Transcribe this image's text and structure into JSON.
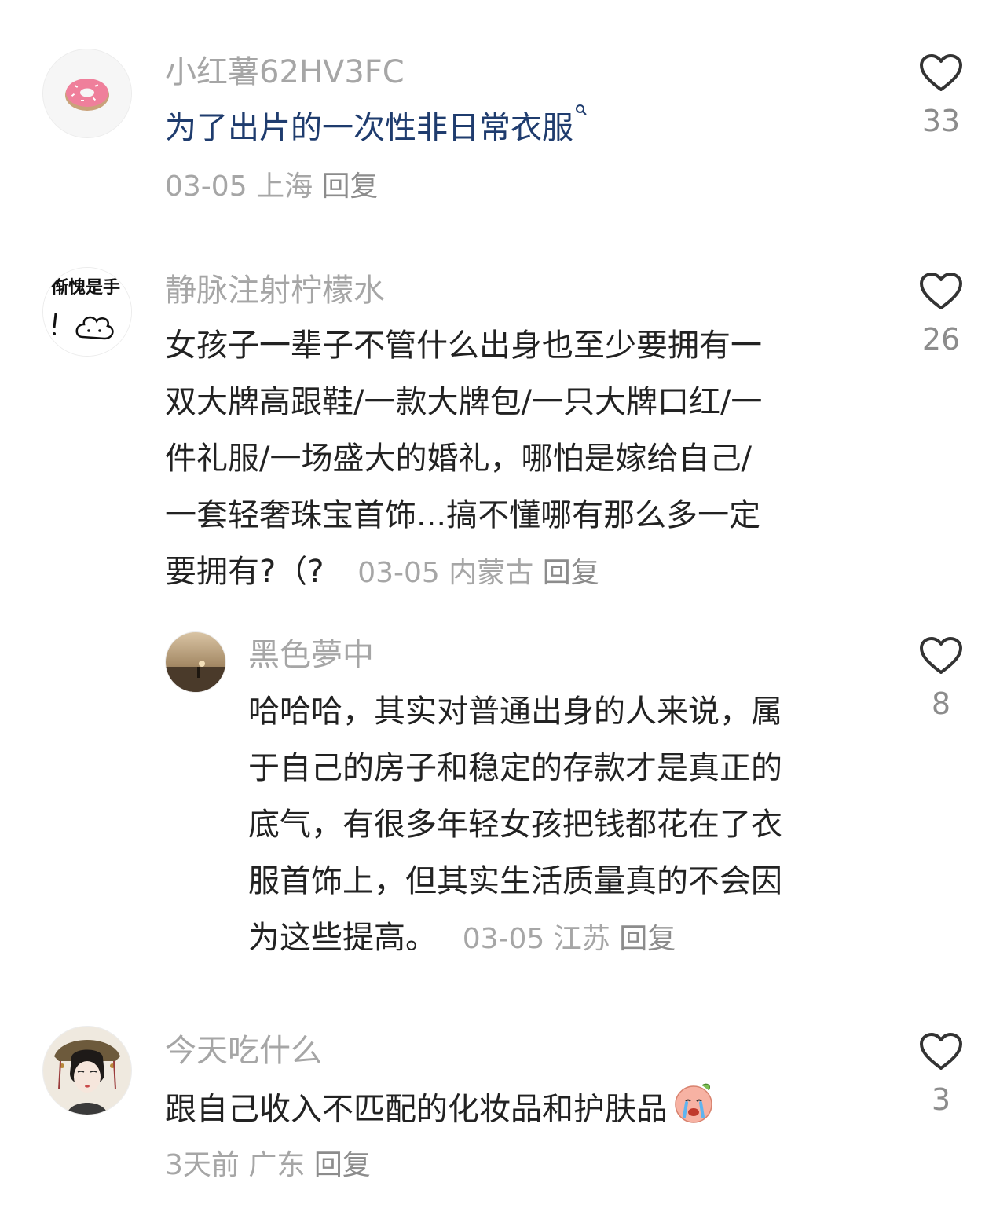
{
  "comments": [
    {
      "username": "小红薯62HV3FC",
      "avatar_icon": "donut-avatar",
      "content": "为了出片的一次性非日常衣服",
      "search_icon": "search-icon",
      "date": "03-05",
      "location": "上海",
      "reply_label": "回复",
      "likes": "33"
    },
    {
      "username": "静脉注射柠檬水",
      "avatar_icon": "handwritten-avatar",
      "avatar_text": "惭愧是手",
      "content_lines": [
        "女孩子一辈子不管什么出身也至少要拥有一",
        "双大牌高跟鞋/一款大牌包/一只大牌口红/一",
        "件礼服/一场盛大的婚礼，哪怕是嫁给自己/",
        "一套轻奢珠宝首饰...搞不懂哪有那么多一定",
        "要拥有?（?"
      ],
      "date": "03-05",
      "location": "内蒙古",
      "reply_label": "回复",
      "likes": "26"
    },
    {
      "username": "黑色夢中",
      "avatar_icon": "sunset-photo-avatar",
      "content_lines": [
        "哈哈哈，其实对普通出身的人来说，属",
        "于自己的房子和稳定的存款才是真正的",
        "底气，有很多年轻女孩把钱都花在了衣",
        "服首饰上，但其实生活质量真的不会因",
        "为这些提高。"
      ],
      "date": "03-05",
      "location": "江苏",
      "reply_label": "回复",
      "likes": "8"
    },
    {
      "username": "今天吃什么",
      "avatar_icon": "illustrated-lady-avatar",
      "content": "跟自己收入不匹配的化妆品和护肤品",
      "emoji_icon": "crying-face-emoji",
      "date": "3天前",
      "location": "广东",
      "reply_label": "回复",
      "likes": "3"
    }
  ],
  "like_icon": "heart-outline-icon"
}
